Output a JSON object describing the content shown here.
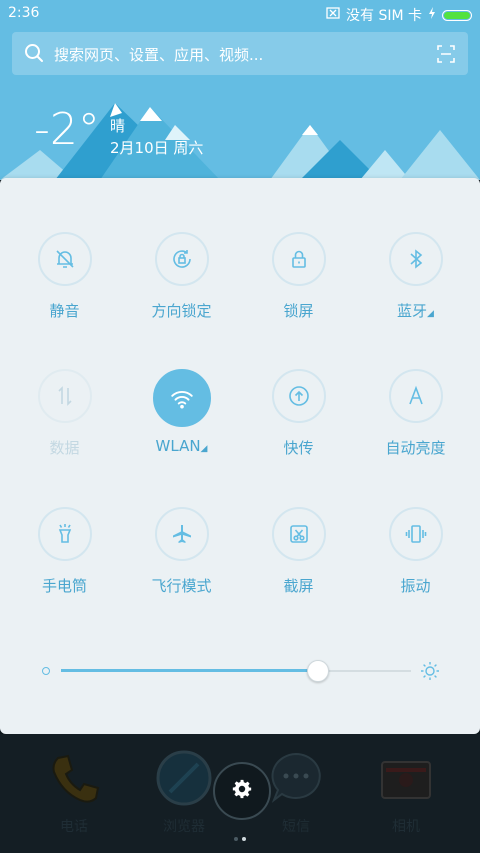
{
  "status_bar": {
    "time": "2:36",
    "carrier": "没有 SIM 卡"
  },
  "search": {
    "placeholder": "搜索网页、设置、应用、视频..."
  },
  "weather": {
    "temperature": "-2°",
    "condition": "晴",
    "date": "2月10日 周六"
  },
  "toggles": [
    {
      "label": "静音",
      "icon": "bell-off-icon",
      "active": false,
      "enabled": true
    },
    {
      "label": "方向锁定",
      "icon": "rotation-lock-icon",
      "active": false,
      "enabled": true
    },
    {
      "label": "锁屏",
      "icon": "lock-icon",
      "active": false,
      "enabled": true
    },
    {
      "label": "蓝牙",
      "icon": "bluetooth-icon",
      "active": false,
      "enabled": true,
      "expandable": true
    },
    {
      "label": "数据",
      "icon": "data-arrows-icon",
      "active": false,
      "enabled": false
    },
    {
      "label": "WLAN",
      "icon": "wifi-icon",
      "active": true,
      "enabled": true,
      "expandable": true
    },
    {
      "label": "快传",
      "icon": "upload-circle-icon",
      "active": false,
      "enabled": true
    },
    {
      "label": "自动亮度",
      "icon": "auto-brightness-icon",
      "active": false,
      "enabled": true
    },
    {
      "label": "手电筒",
      "icon": "flashlight-icon",
      "active": false,
      "enabled": true
    },
    {
      "label": "飞行模式",
      "icon": "airplane-icon",
      "active": false,
      "enabled": true
    },
    {
      "label": "截屏",
      "icon": "screenshot-icon",
      "active": false,
      "enabled": true
    },
    {
      "label": "振动",
      "icon": "vibrate-icon",
      "active": false,
      "enabled": true
    }
  ],
  "brightness": {
    "level": 0.73
  },
  "dock": [
    {
      "label": "电话",
      "icon": "phone-icon"
    },
    {
      "label": "浏览器",
      "icon": "browser-icon"
    },
    {
      "label": "短信",
      "icon": "message-icon"
    },
    {
      "label": "相机",
      "icon": "camera-icon"
    }
  ],
  "colors": {
    "accent": "#64bde3",
    "sky": "#64bde3",
    "panel": "#ebf1f4"
  }
}
